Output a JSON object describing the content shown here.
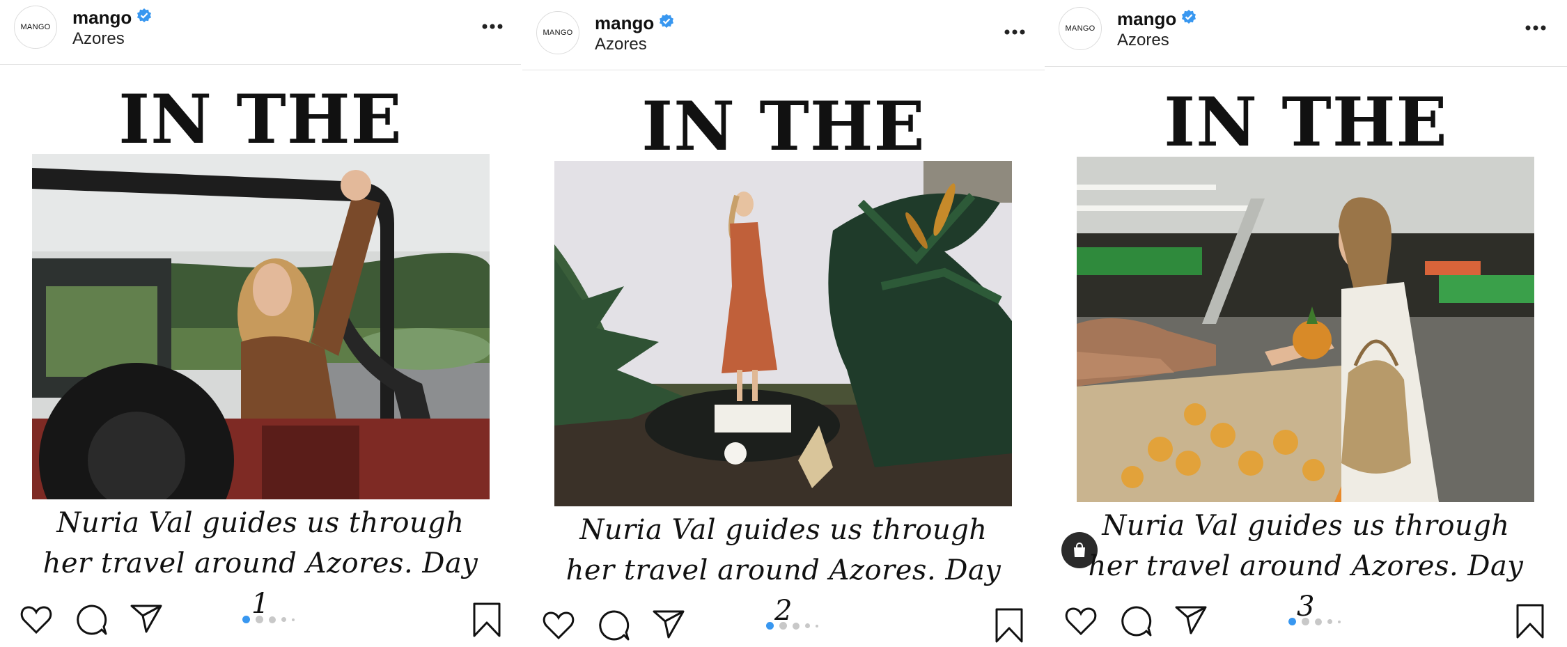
{
  "posts": [
    {
      "username": "mango",
      "location": "Azores",
      "avatar_text": "MANGO",
      "title": "IN THE LOOP",
      "caption_line1": "Nuria Val guides us through",
      "caption_line2": "her travel around Azores. Day 1"
    },
    {
      "username": "mango",
      "location": "Azores",
      "avatar_text": "MANGO",
      "title": "IN THE LOOP",
      "caption_line1": "Nuria Val guides us through",
      "caption_line2": "her travel around Azores. Day 2"
    },
    {
      "username": "mango",
      "location": "Azores",
      "avatar_text": "MANGO",
      "title": "IN THE LOOP",
      "caption_line1": "Nuria Val guides us through",
      "caption_line2": "her travel around Azores. Day 3"
    }
  ],
  "carousel": {
    "total": 5,
    "active_index": 0
  },
  "colors": {
    "verified": "#3897f0",
    "active_dot": "#3897f0",
    "inactive_dot": "#c8c8c8",
    "text": "#111111"
  },
  "icons": [
    "verified-badge-icon",
    "more-options-icon",
    "heart-icon",
    "comment-icon",
    "share-icon",
    "bookmark-icon",
    "shopping-bag-icon"
  ]
}
